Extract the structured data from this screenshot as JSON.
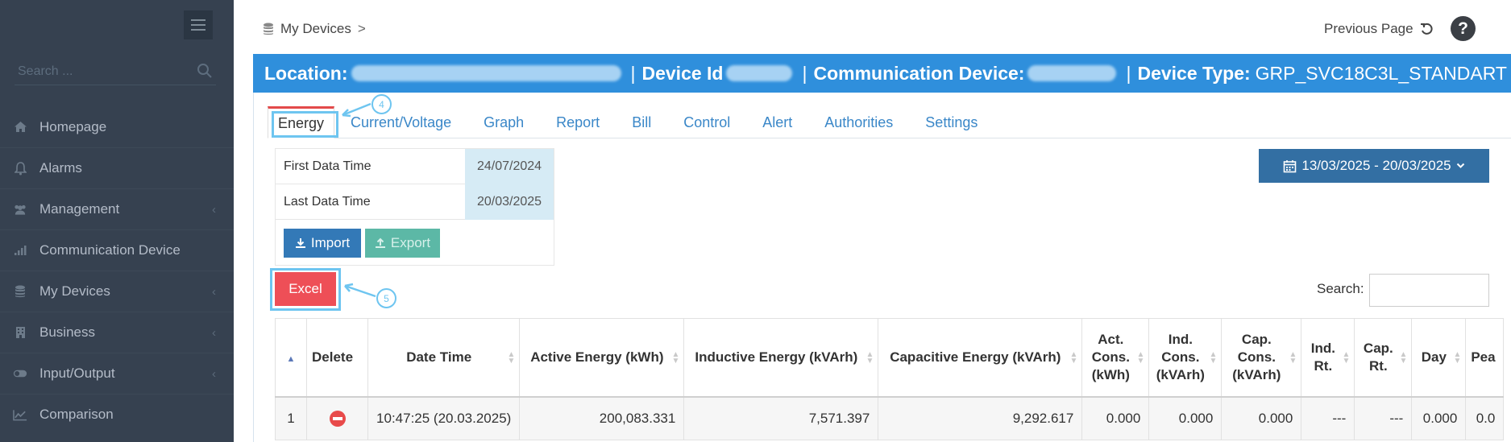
{
  "sidebar": {
    "search_placeholder": "Search ...",
    "items": [
      {
        "label": "Homepage",
        "icon": "home-icon",
        "has_arrow": false
      },
      {
        "label": "Alarms",
        "icon": "bell-icon",
        "has_arrow": false
      },
      {
        "label": "Management",
        "icon": "users-icon",
        "has_arrow": true
      },
      {
        "label": "Communication Device",
        "icon": "signal-icon",
        "has_arrow": false
      },
      {
        "label": "My Devices",
        "icon": "database-icon",
        "has_arrow": true
      },
      {
        "label": "Business",
        "icon": "building-icon",
        "has_arrow": true
      },
      {
        "label": "Input/Output",
        "icon": "toggle-icon",
        "has_arrow": true
      },
      {
        "label": "Comparison",
        "icon": "chart-line-icon",
        "has_arrow": false
      }
    ]
  },
  "breadcrumb": {
    "label": "My Devices",
    "separator": ">"
  },
  "topbar": {
    "previous_page": "Previous Page",
    "help": "?"
  },
  "device": {
    "location_label": "Location:",
    "device_id_label": "Device Id",
    "comm_device_label": "Communication Device:",
    "device_type_label": "Device Type:",
    "device_type_value": "GRP_SVC18C3L_STANDART",
    "separator": "|"
  },
  "tabs": [
    "Energy",
    "Current/Voltage",
    "Graph",
    "Report",
    "Bill",
    "Control",
    "Alert",
    "Authorities",
    "Settings"
  ],
  "info": {
    "first_label": "First Data Time",
    "first_value": "24/07/2024",
    "last_label": "Last Data Time",
    "last_value": "20/03/2025"
  },
  "buttons": {
    "import": "Import",
    "export": "Export",
    "excel": "Excel"
  },
  "date_range": "13/03/2025 - 20/03/2025",
  "search": {
    "label": "Search:",
    "value": ""
  },
  "annotations": {
    "tab_callout": "4",
    "excel_callout": "5"
  },
  "table": {
    "headers": [
      "",
      "Delete",
      "Date Time",
      "Active Energy (kWh)",
      "Inductive Energy (kVArh)",
      "Capacitive Energy (kVArh)",
      "Act. Cons. (kWh)",
      "Ind. Cons. (kVArh)",
      "Cap. Cons. (kVArh)",
      "Ind. Rt.",
      "Cap. Rt.",
      "Day",
      "Pea"
    ],
    "rows": [
      [
        "1",
        "",
        "10:47:25 (20.03.2025)",
        "200,083.331",
        "7,571.397",
        "9,292.617",
        "0.000",
        "0.000",
        "0.000",
        "---",
        "---",
        "0.000",
        "0.0"
      ]
    ]
  },
  "colors": {
    "sidebar_bg": "#364150",
    "header_blue": "#2f8fdc",
    "excel_red": "#ee4f57",
    "import_blue": "#3379b7",
    "export_teal": "#5cb8a6",
    "date_range_blue": "#336fa3",
    "annotation_blue": "#6ec5f0"
  }
}
